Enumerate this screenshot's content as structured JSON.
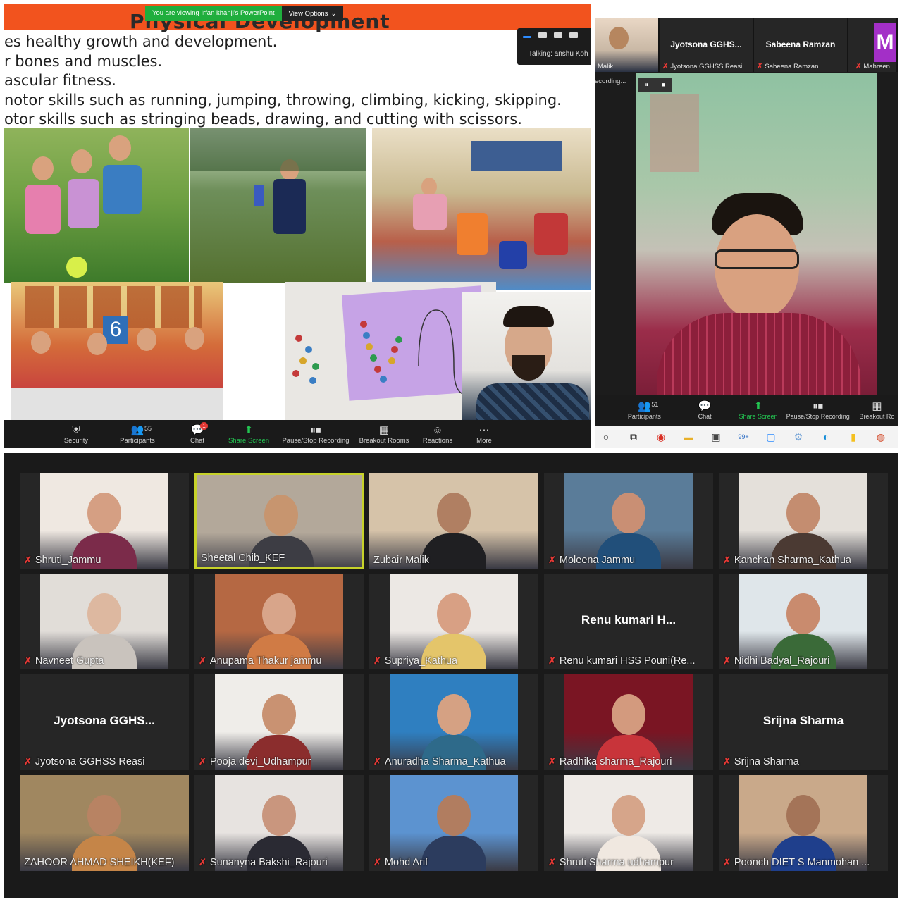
{
  "presentation": {
    "slide_title": "Physical Development",
    "banner_message": "You are viewing Irfan khanji's PowerPoint",
    "view_options_label": "View Options",
    "talking_label": "Talking: anshu Koh",
    "bullets": [
      "es healthy growth and development.",
      "r bones and muscles.",
      "ascular fitness.",
      "notor skills such as running, jumping, throwing, climbing, kicking, skipping.",
      "otor skills such as stringing beads, drawing, and cutting with scissors."
    ],
    "toolbar": {
      "security": "Security",
      "participants": "Participants",
      "participants_count": "55",
      "chat": "Chat",
      "chat_badge": "1",
      "share_screen": "Share Screen",
      "recording": "Pause/Stop Recording",
      "breakout": "Breakout Rooms",
      "reactions": "Reactions",
      "more": "More"
    }
  },
  "speaker_view": {
    "strip": [
      {
        "name": "",
        "caption": "Malik"
      },
      {
        "name": "Jyotsona GGHS...",
        "caption": "Jyotsona GGHSS Reasi"
      },
      {
        "name": "Sabeena Ramzan",
        "caption": "Sabeena Ramzan"
      },
      {
        "name": "M",
        "caption": "Mahreen"
      }
    ],
    "recording_label": "ecording...",
    "toolbar": {
      "participants": "Participants",
      "participants_count": "51",
      "chat": "Chat",
      "share_screen": "Share Screen",
      "recording": "Pause/Stop Recording",
      "breakout": "Breakout Ro"
    },
    "taskbar_badge": "99+"
  },
  "gallery": {
    "tiles": [
      {
        "label": "Shruti_Jammu",
        "big": ""
      },
      {
        "label": "Sheetal Chib_KEF",
        "big": ""
      },
      {
        "label": "Zubair Malik",
        "big": ""
      },
      {
        "label": "Moleena Jammu",
        "big": ""
      },
      {
        "label": "Kanchan Sharma_Kathua",
        "big": ""
      },
      {
        "label": "Navneet Gupta",
        "big": ""
      },
      {
        "label": "Anupama Thakur jammu",
        "big": ""
      },
      {
        "label": "Supriya_Kathua",
        "big": ""
      },
      {
        "label": "Renu kumari  HSS Pouni(Re...",
        "big": "Renu kumari  H..."
      },
      {
        "label": "Nidhi Badyal_Rajouri",
        "big": ""
      },
      {
        "label": "Jyotsona GGHSS Reasi",
        "big": "Jyotsona  GGHS..."
      },
      {
        "label": "Pooja devi_Udhampur",
        "big": ""
      },
      {
        "label": "Anuradha Sharma_Kathua",
        "big": ""
      },
      {
        "label": "Radhika sharma_Rajouri",
        "big": ""
      },
      {
        "label": "Srijna Sharma",
        "big": "Srijna Sharma"
      },
      {
        "label": "ZAHOOR AHMAD SHEIKH(KEF)",
        "big": ""
      },
      {
        "label": "Sunanyna Bakshi_Rajouri",
        "big": ""
      },
      {
        "label": "Mohd Arif",
        "big": ""
      },
      {
        "label": "Shruti Sharma udhampur",
        "big": ""
      },
      {
        "label": "Poonch DIET S Manmohan ...",
        "big": ""
      }
    ]
  },
  "colors": {
    "zoom_green": "#23c552",
    "slide_orange": "#f2531e",
    "active_speaker_border": "#c7d22a",
    "muted_red": "#e53935"
  }
}
